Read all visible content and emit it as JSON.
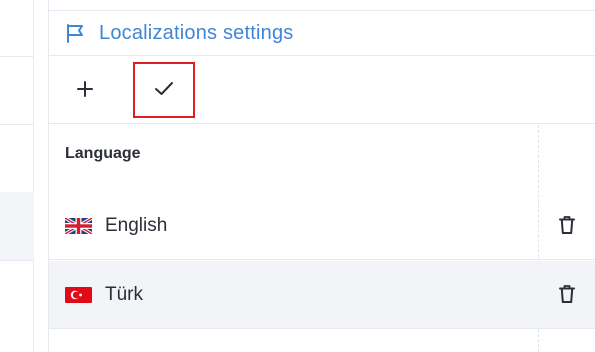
{
  "panel": {
    "title": "Localizations settings",
    "title_icon": "flag-outline-icon",
    "accent_color": "#3f86d9"
  },
  "toolbar": {
    "add_icon": "plus-icon",
    "save_icon": "checkmark-icon",
    "highlight_color": "#e02020"
  },
  "table": {
    "column_header": "Language",
    "rows": [
      {
        "label": "English",
        "flag_icon": "uk-flag-icon",
        "action_icon": "trash-icon"
      },
      {
        "label": "Türk",
        "flag_icon": "turkey-flag-icon",
        "action_icon": "trash-icon"
      }
    ]
  }
}
